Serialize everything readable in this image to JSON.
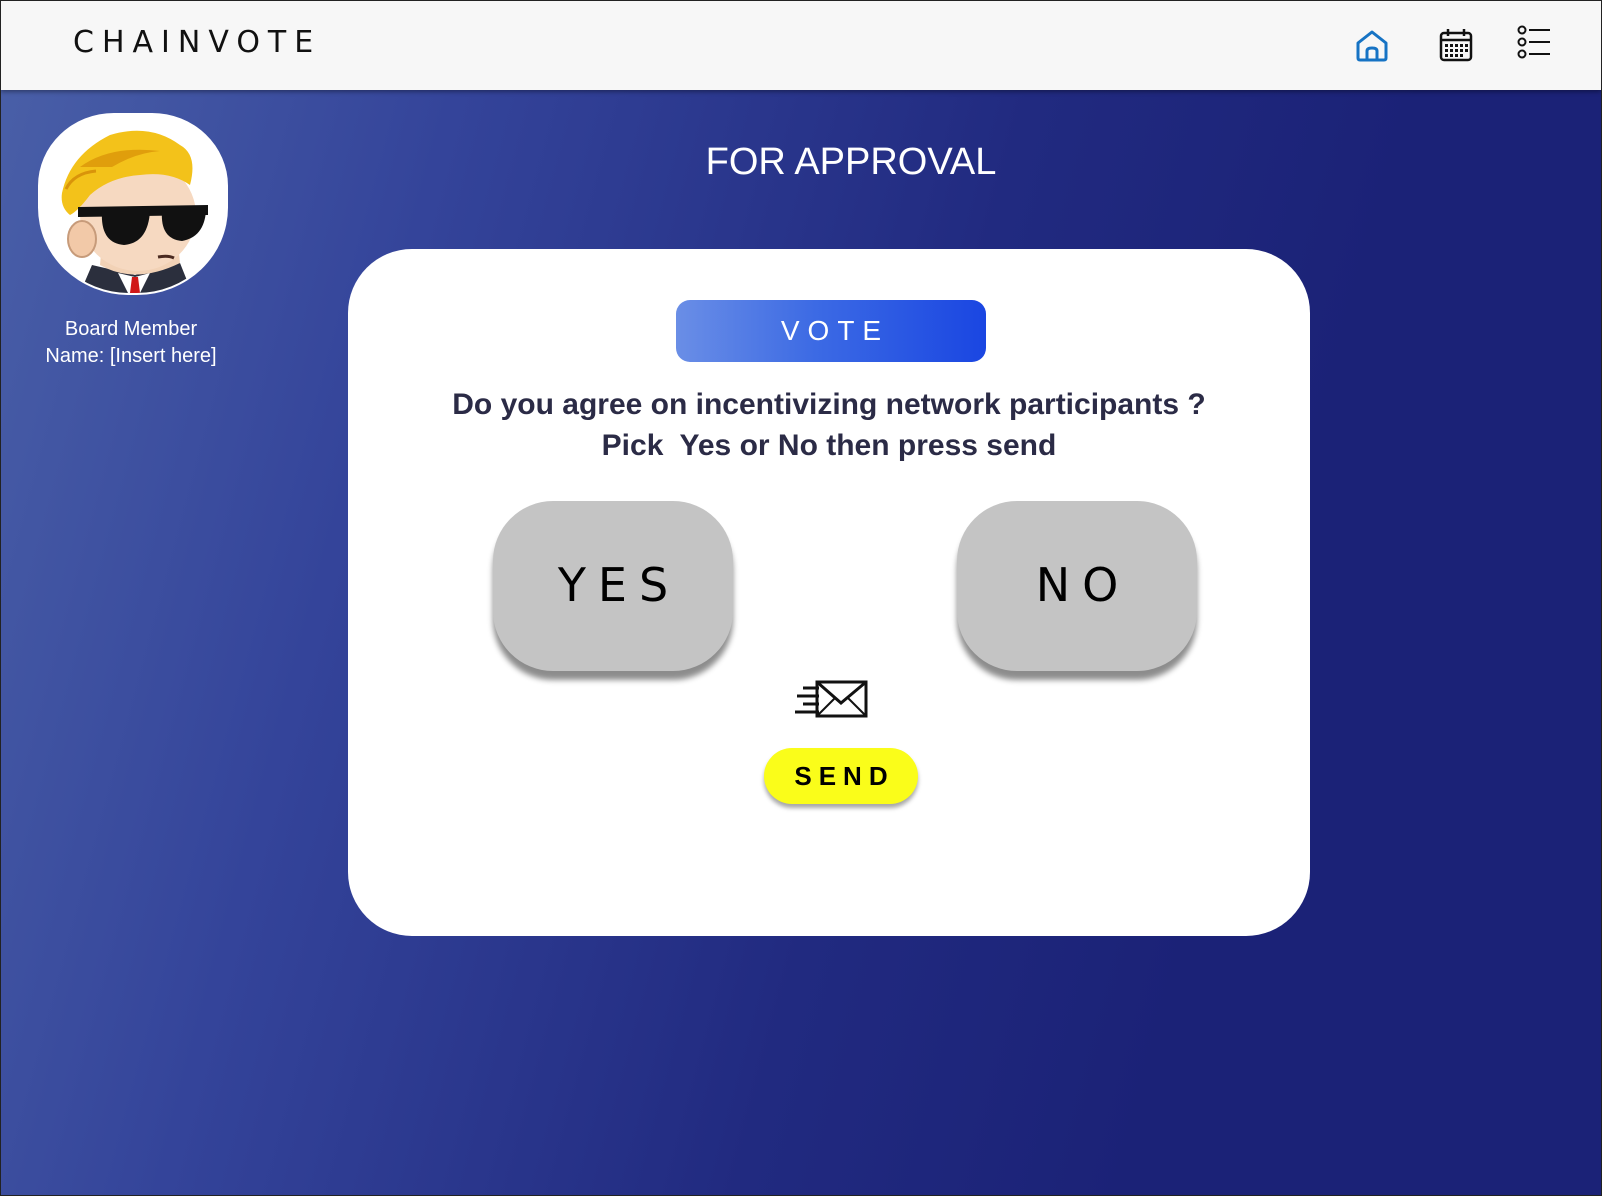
{
  "header": {
    "brand": "CHAINVOTE",
    "nav": [
      {
        "icon": "home-icon",
        "color": "#1673c4"
      },
      {
        "icon": "calendar-icon",
        "color": "#111111"
      },
      {
        "icon": "list-icon",
        "color": "#111111"
      }
    ]
  },
  "sidebar": {
    "avatar_icon": "avatar-cartoon-sunglasses",
    "role": "Board Member",
    "name_line": "Name: [Insert here]"
  },
  "main": {
    "title": "FOR APPROVAL",
    "card": {
      "badge": "VOTE",
      "question_line1": "Do you agree on incentivizing network participants ?",
      "question_line2": "Pick  Yes or No then press send",
      "yes_label": "YES",
      "no_label": "NO",
      "send_icon": "send-mail-icon",
      "send_label": "SEND"
    }
  },
  "colors": {
    "background_start": "#4a60a8",
    "background_end": "#1b2277",
    "badge": "#3c6ae4",
    "send_button": "#fafd1a",
    "choice_button": "#c4c4c4"
  }
}
